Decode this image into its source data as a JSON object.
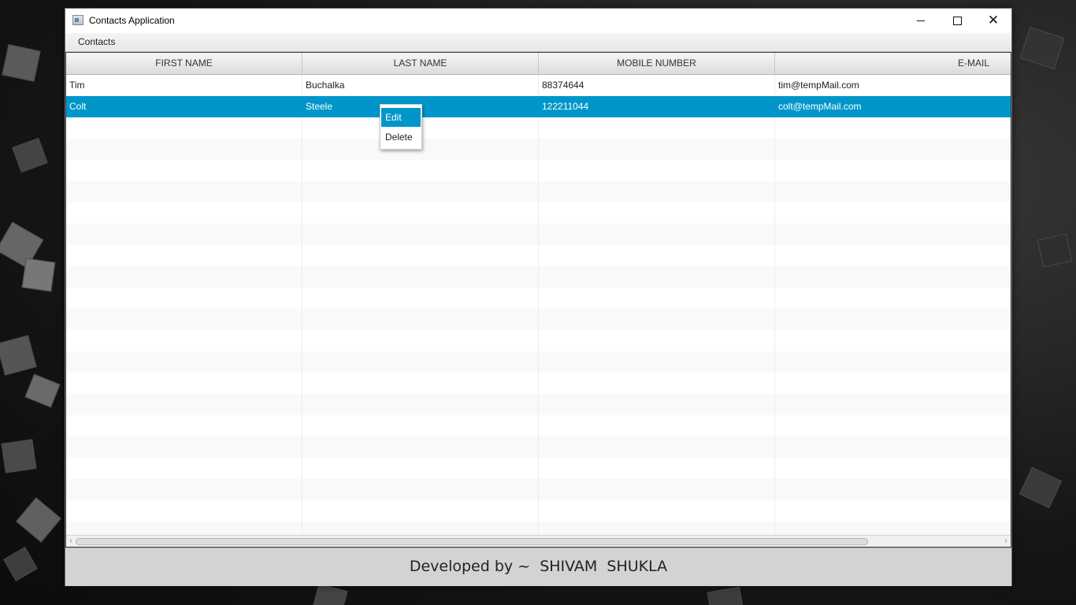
{
  "window": {
    "title": "Contacts Application",
    "minimize_icon": "minimize-icon",
    "maximize_icon": "maximize-icon",
    "close_icon": "close-icon",
    "close_glyph": "✕"
  },
  "menubar": {
    "items": [
      {
        "label": "Contacts"
      }
    ]
  },
  "table": {
    "columns": [
      "FIRST  NAME",
      "LAST  NAME",
      "MOBILE  NUMBER",
      "E-MAIL"
    ],
    "rows": [
      {
        "first_name": "Tim",
        "last_name": "Buchalka",
        "mobile": "88374644",
        "email": "tim@tempMail.com",
        "selected": false
      },
      {
        "first_name": "Colt",
        "last_name": "Steele",
        "mobile": "122211044",
        "email": "colt@tempMail.com",
        "selected": true
      }
    ],
    "selection_color": "#0096c9"
  },
  "context_menu": {
    "items": [
      {
        "label": "Edit",
        "highlighted": true
      },
      {
        "label": "Delete",
        "highlighted": false
      }
    ]
  },
  "footer": {
    "text": "Developed by ~  SHIVAM  SHUKLA"
  },
  "scrollbar": {
    "left_glyph": "‹",
    "right_glyph": "›"
  }
}
